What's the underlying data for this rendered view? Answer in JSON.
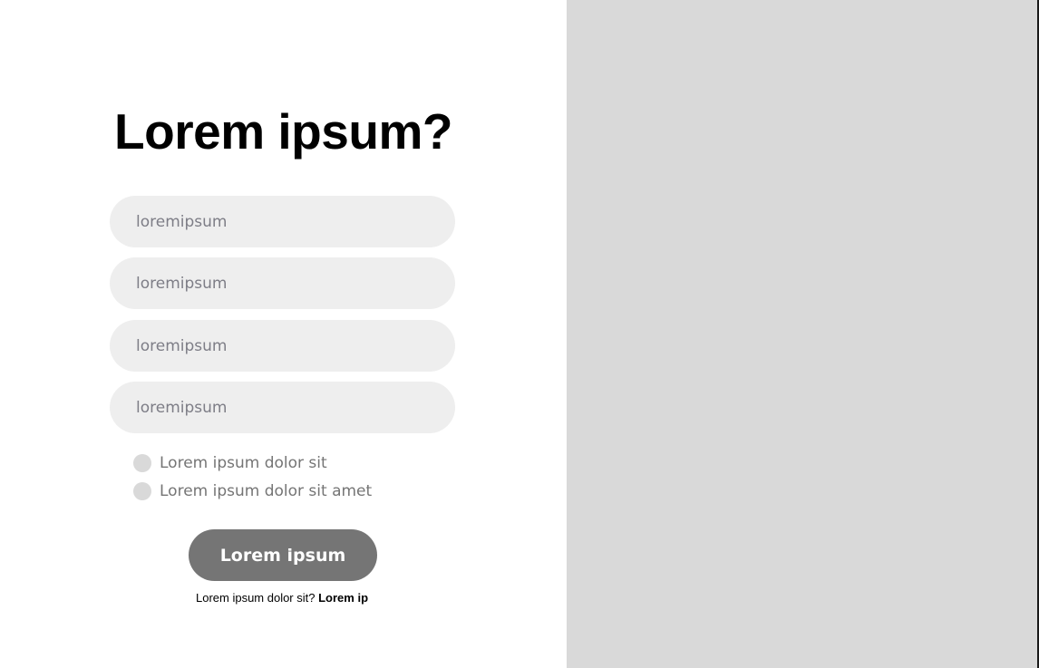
{
  "form": {
    "title": "Lorem ipsum?",
    "fields": [
      {
        "placeholder": "loremipsum"
      },
      {
        "placeholder": "loremipsum"
      },
      {
        "placeholder": "loremipsum"
      },
      {
        "placeholder": "loremipsum"
      }
    ],
    "options": [
      {
        "label": "Lorem ipsum dolor sit"
      },
      {
        "label": "Lorem ipsum dolor sit amet"
      }
    ],
    "submit_label": "Lorem ipsum",
    "footer": {
      "text": "Lorem ipsum dolor sit?",
      "link_label": "Lorem ip"
    }
  },
  "colors": {
    "field_background": "#eeeeee",
    "button_background": "#757575",
    "side_panel": "#d9d9d9"
  }
}
